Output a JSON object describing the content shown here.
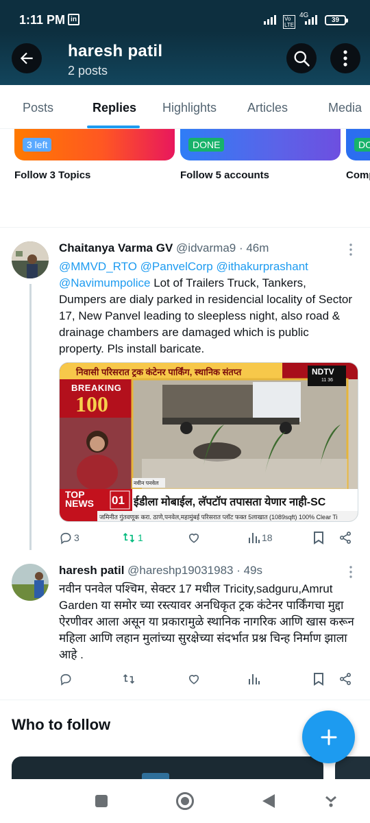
{
  "status_bar": {
    "time": "1:11 PM",
    "network": "4G",
    "battery": "39"
  },
  "header": {
    "title": "haresh patil",
    "subtitle": "2 posts"
  },
  "tabs": [
    {
      "label": "Posts"
    },
    {
      "label": "Replies"
    },
    {
      "label": "Highlights"
    },
    {
      "label": "Articles"
    },
    {
      "label": "Media"
    }
  ],
  "onboarding_cards": [
    {
      "badge": "3 left",
      "label": "Follow 3 Topics"
    },
    {
      "badge": "DONE",
      "label": "Follow 5 accounts"
    },
    {
      "badge": "DO",
      "label": "Comp"
    }
  ],
  "tweets": [
    {
      "name": "Chaitanya Varma GV",
      "handle": "@idvarma9",
      "time": "· 46m",
      "mentions_line1": "@MMVD_RTO @PanvelCorp @ithakurprashant",
      "mention_line2": "@Navimumpolice",
      "text": " Lot of Trailers Truck, Tankers, Dumpers are dialy parked in residencial locality of Sector 17, New Panvel leading to sleepless night, also road & drainage chambers are damaged which is public property. Pls install baricate.",
      "media": {
        "headline_top": "निवासी परिसरात ट्रक कंटेनर पार्किंग, स्थानिक संतप्त",
        "channel": "NDTV",
        "clock": "11 36",
        "breaking": "BREAKING",
        "breaking_number": "100",
        "location_tag": "नवीन पनवेल",
        "top_news": "TOP NEWS",
        "ticker_number": "01",
        "ticker_text": "ईडीला मोबाईल, लॅपटॉप तपासता येणार नाही-SC",
        "ad_ticker": "जमिनीत गुंतवणूक करा. ठाणे,पनवेल,महामुंबई परिसरात प्लॉट फक्त 5लाखात (1089sqft) 100% Clear Ti"
      },
      "replies": "3",
      "reposts": "1",
      "likes": "",
      "views": "18"
    },
    {
      "name": "haresh patil",
      "handle": "@hareshp19031983",
      "time": "· 49s",
      "text": "नवीन पनवेल  पश्चिम, सेक्टर 17 मधील  Tricity,sadguru,Amrut Garden या समोर च्या रस्त्यावर अनधिकृत ट्रक कंटेनर पार्किंगचा मुद्दा ऐरणीवर आला असून या प्रकारामुळे स्थानिक  नागरिक आणि खास करून महिला आणि लहान मुलांच्या सुरक्षेच्या संदर्भात प्रश्न चिन्ह निर्माण झाला आहे .",
      "replies": "",
      "reposts": "",
      "likes": "",
      "views": ""
    }
  ],
  "who_to_follow": {
    "title": "Who to follow"
  },
  "colors": {
    "accent": "#1d9bf0",
    "repost_active": "#00ba7c",
    "header_bg": "#0d2f3f"
  },
  "icons": [
    "back-arrow-icon",
    "search-icon",
    "more-vertical-icon",
    "reply-icon",
    "repost-icon",
    "like-icon",
    "views-icon",
    "bookmark-icon",
    "share-icon",
    "compose-plus-icon"
  ]
}
